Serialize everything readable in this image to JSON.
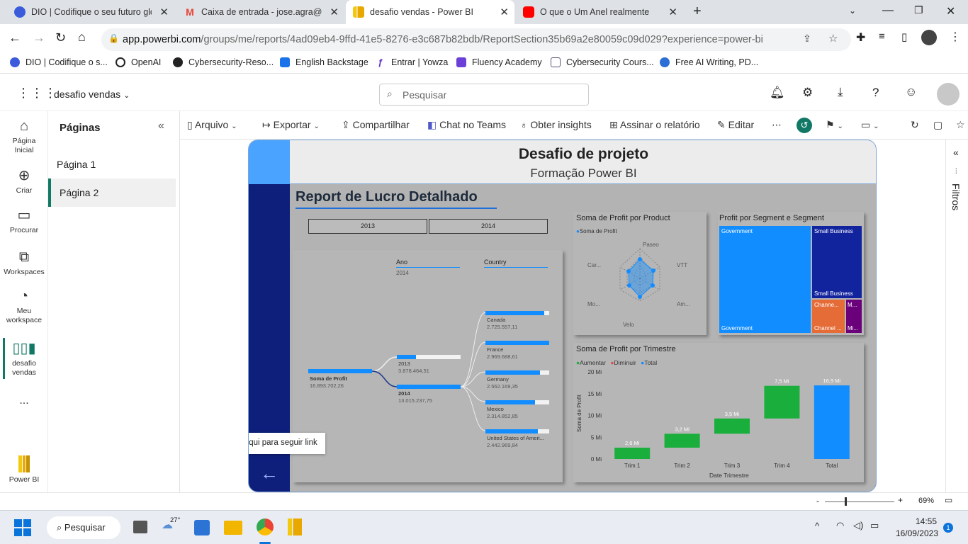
{
  "browser": {
    "tabs": [
      {
        "title": "DIO | Codifique o seu futuro glob",
        "color": "#3b5bdb"
      },
      {
        "title": "Caixa de entrada - jose.agra@ee.",
        "color": "#ea4335"
      },
      {
        "title": "desafio vendas - Power BI",
        "color": "#f2c811"
      },
      {
        "title": "O que o Um Anel realmente",
        "color": "#ff0000"
      }
    ],
    "url_host": "app.powerbi.com",
    "url_path": "/groups/me/reports/4ad09eb4-9ffd-41e5-8276-e3c687b82bdb/ReportSection35b69a2e80059c09d029?experience=power-bi",
    "bookmarks": [
      "DIO | Codifique o s...",
      "OpenAI",
      "Cybersecurity-Reso...",
      "English Backstage",
      "Entrar | Yowza",
      "Fluency Academy",
      "Cybersecurity Cours...",
      "Free AI Writing, PD..."
    ]
  },
  "app": {
    "workspace": "desafio vendas",
    "search_placeholder": "Pesquisar",
    "nav": [
      {
        "label": "Página\nInicial"
      },
      {
        "label": "Criar"
      },
      {
        "label": "Procurar"
      },
      {
        "label": "Workspaces"
      },
      {
        "label": "Meu\nworkspace"
      },
      {
        "label": "desafio\nvendas"
      },
      {
        "label": "..."
      }
    ],
    "powerbi_label": "Power BI",
    "pages_title": "Páginas",
    "pages": [
      "Página 1",
      "Página 2"
    ],
    "toolbar": [
      "Arquivo",
      "Exportar",
      "Compartilhar",
      "Chat no Teams",
      "Obter insights",
      "Assinar o relatório",
      "Editar"
    ],
    "filters_label": "Filtros",
    "zoom": "69%"
  },
  "report": {
    "title": "Desafio de projeto",
    "subtitle": "Formação Power BI",
    "heading": "Report de Lucro Detalhado",
    "slicer": [
      "2013",
      "2014"
    ],
    "tooltip": "Clique aqui para seguir link",
    "tree": {
      "col1": "Ano",
      "col1_sub": "2014",
      "col2": "Country",
      "root_label": "Soma de Profit",
      "root_value": "16.893.702,26",
      "y2013": "2013",
      "y2013_value": "3.878.464,51",
      "y2014": "2014",
      "y2014_value": "13.015.237,75",
      "countries": [
        {
          "name": "Canada",
          "value": "2.725.557,11",
          "share": 0.92
        },
        {
          "name": "France",
          "value": "2.969.688,61",
          "share": 1.0
        },
        {
          "name": "Germany",
          "value": "2.562.169,35",
          "share": 0.86
        },
        {
          "name": "Mexico",
          "value": "2.314.852,85",
          "share": 0.78
        },
        {
          "name": "United States of Ameri...",
          "value": "2.442.969,84",
          "share": 0.82
        }
      ]
    },
    "radar": {
      "title": "Soma de Profit por Product",
      "legend": "Soma de Profit",
      "axes": [
        "Paseo",
        "VTT",
        "Am...",
        "Velo",
        "Mo...",
        "Car..."
      ]
    },
    "treemap": {
      "title": "Profit por Segment e Segment",
      "cells": [
        "Government",
        "Government",
        "Small Business",
        "Small Business",
        "Channe...",
        "Channel ...",
        "M...",
        "Mi..."
      ]
    },
    "waterfall": {
      "title": "Soma de Profit por Trimestre",
      "legend": [
        "Aumentar",
        "Diminuir",
        "Total"
      ],
      "ylabel": "Soma de Profit",
      "xlabel": "Date Trimestre",
      "yticks": [
        "20 Mi",
        "15 Mi",
        "10 Mi",
        "5 Mi",
        "0 Mi"
      ]
    }
  },
  "chart_data": [
    {
      "type": "bar",
      "title": "Soma de Profit por Trimestre",
      "xlabel": "Date Trimestre",
      "ylabel": "Soma de Profit",
      "categories": [
        "Trim 1",
        "Trim 2",
        "Trim 3",
        "Trim 4",
        "Total"
      ],
      "values": [
        2.6,
        3.2,
        3.5,
        7.5,
        16.9
      ],
      "labels": [
        "2,6 Mi",
        "3,2 Mi",
        "3,5 Mi",
        "7,5 Mi",
        "16,9 Mi"
      ],
      "ylim": [
        0,
        20
      ],
      "colors": {
        "increase": "#1aaf3c",
        "decrease": "#e04b4b",
        "total": "#118dff"
      }
    }
  ],
  "taskbar": {
    "search": "Pesquisar",
    "temp": "27°",
    "time": "14:55",
    "date": "16/09/2023",
    "notif": "1"
  }
}
